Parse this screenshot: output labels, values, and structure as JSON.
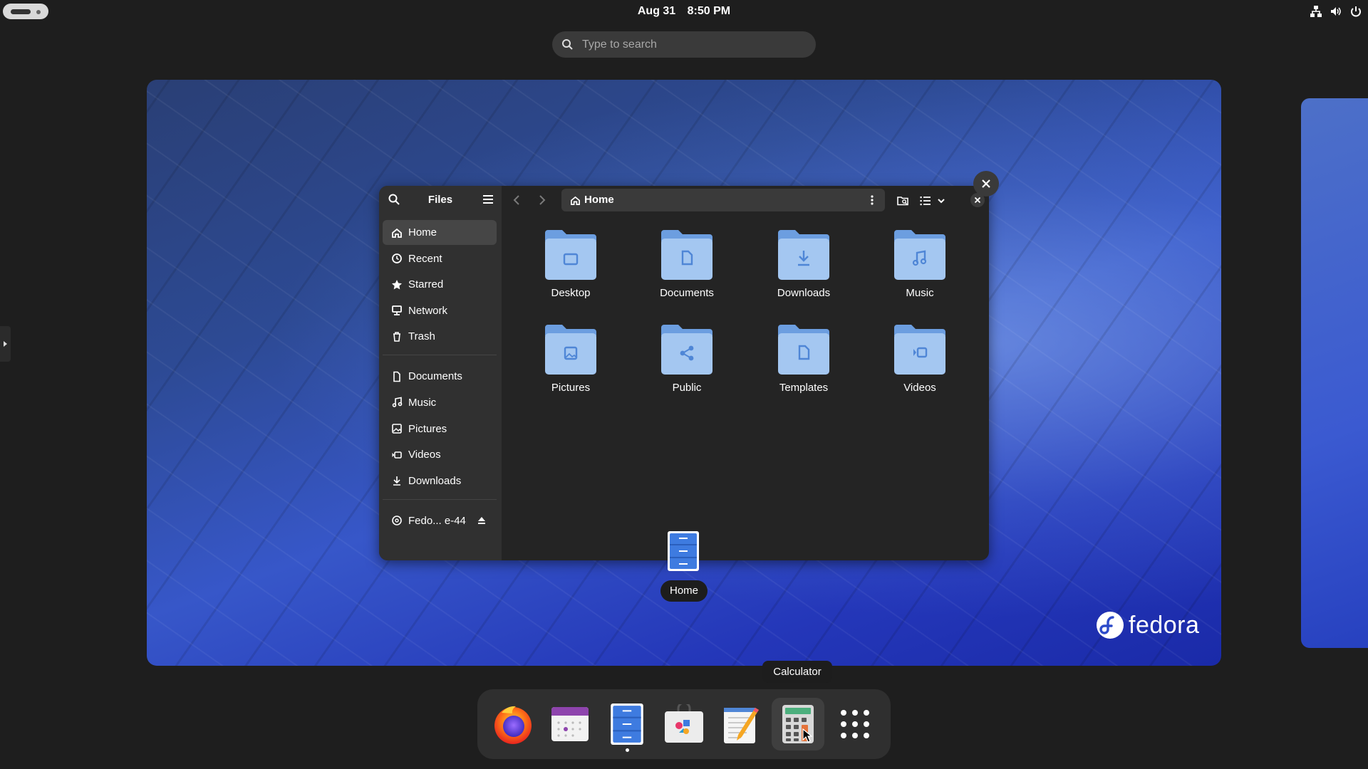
{
  "topbar": {
    "date": "Aug 31",
    "time": "8:50 PM",
    "tray_icons": [
      "network-icon",
      "volume-icon",
      "power-icon"
    ]
  },
  "search": {
    "placeholder": "Type to search"
  },
  "files_window": {
    "sidebar_title": "Files",
    "places": [
      {
        "label": "Home",
        "icon": "home-icon",
        "active": true
      },
      {
        "label": "Recent",
        "icon": "clock-icon"
      },
      {
        "label": "Starred",
        "icon": "star-icon"
      },
      {
        "label": "Network",
        "icon": "network-icon"
      },
      {
        "label": "Trash",
        "icon": "trash-icon"
      }
    ],
    "bookmarks": [
      {
        "label": "Documents",
        "icon": "document-icon"
      },
      {
        "label": "Music",
        "icon": "music-icon"
      },
      {
        "label": "Pictures",
        "icon": "picture-icon"
      },
      {
        "label": "Videos",
        "icon": "video-icon"
      },
      {
        "label": "Downloads",
        "icon": "download-icon"
      }
    ],
    "devices": [
      {
        "label": "Fedo... e-44",
        "icon": "disc-icon"
      }
    ],
    "path": "Home",
    "folders": [
      {
        "name": "Desktop",
        "emblem": "folder"
      },
      {
        "name": "Documents",
        "emblem": "document"
      },
      {
        "name": "Downloads",
        "emblem": "download"
      },
      {
        "name": "Music",
        "emblem": "music"
      },
      {
        "name": "Pictures",
        "emblem": "picture"
      },
      {
        "name": "Public",
        "emblem": "share"
      },
      {
        "name": "Templates",
        "emblem": "document"
      },
      {
        "name": "Videos",
        "emblem": "video"
      }
    ],
    "window_label": "Home"
  },
  "dash": {
    "tooltip": "Calculator",
    "apps": [
      {
        "name": "Firefox",
        "icon": "firefox-icon"
      },
      {
        "name": "Calendar",
        "icon": "calendar-icon"
      },
      {
        "name": "Files",
        "icon": "files-icon",
        "running": true
      },
      {
        "name": "Software",
        "icon": "software-icon"
      },
      {
        "name": "Text Editor",
        "icon": "text-editor-icon"
      },
      {
        "name": "Calculator",
        "icon": "calculator-icon",
        "hovered": true
      },
      {
        "name": "Show Apps",
        "icon": "app-grid-icon"
      }
    ]
  },
  "colors": {
    "folder_light": "#a4c7f1",
    "folder_dark": "#6c9ee0",
    "accent": "#3584e4"
  },
  "branding": {
    "logo_text": "fedora"
  }
}
